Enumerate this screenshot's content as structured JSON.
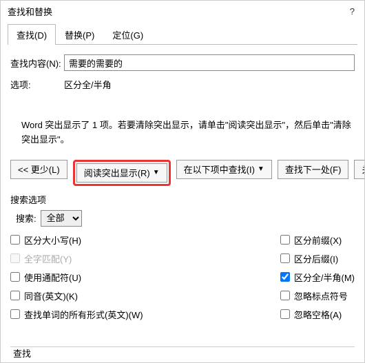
{
  "title": "查找和替换",
  "help_icon": "?",
  "tabs": {
    "find": "查找(D)",
    "replace": "替换(P)",
    "goto": "定位(G)"
  },
  "form": {
    "content_label": "查找内容(N):",
    "content_value": "需要的需要的",
    "options_label": "选项:",
    "options_value": "区分全/半角"
  },
  "info_text": "Word 突出显示了 1 项。若要清除突出显示，请单击\"阅读突出显示\"，然后单击\"清除突出显示\"。",
  "buttons": {
    "less": "<< 更少(L)",
    "highlight": "阅读突出显示(R)",
    "findin": "在以下项中查找(I)",
    "findnext": "查找下一处(F)",
    "close": "关闭"
  },
  "search_options_label": "搜索选项",
  "search": {
    "label": "搜索:",
    "value": "全部"
  },
  "checks": {
    "left": [
      {
        "label": "区分大小写(H)",
        "checked": false,
        "disabled": false
      },
      {
        "label": "全字匹配(Y)",
        "checked": false,
        "disabled": true
      },
      {
        "label": "使用通配符(U)",
        "checked": false,
        "disabled": false
      },
      {
        "label": "同音(英文)(K)",
        "checked": false,
        "disabled": false
      },
      {
        "label": "查找单词的所有形式(英文)(W)",
        "checked": false,
        "disabled": false
      }
    ],
    "right": [
      {
        "label": "区分前缀(X)",
        "checked": false
      },
      {
        "label": "区分后缀(I)",
        "checked": false
      },
      {
        "label": "区分全/半角(M)",
        "checked": true
      },
      {
        "label": "忽略标点符号",
        "checked": false
      },
      {
        "label": "忽略空格(A)",
        "checked": false
      }
    ]
  },
  "bottom_label": "查找"
}
